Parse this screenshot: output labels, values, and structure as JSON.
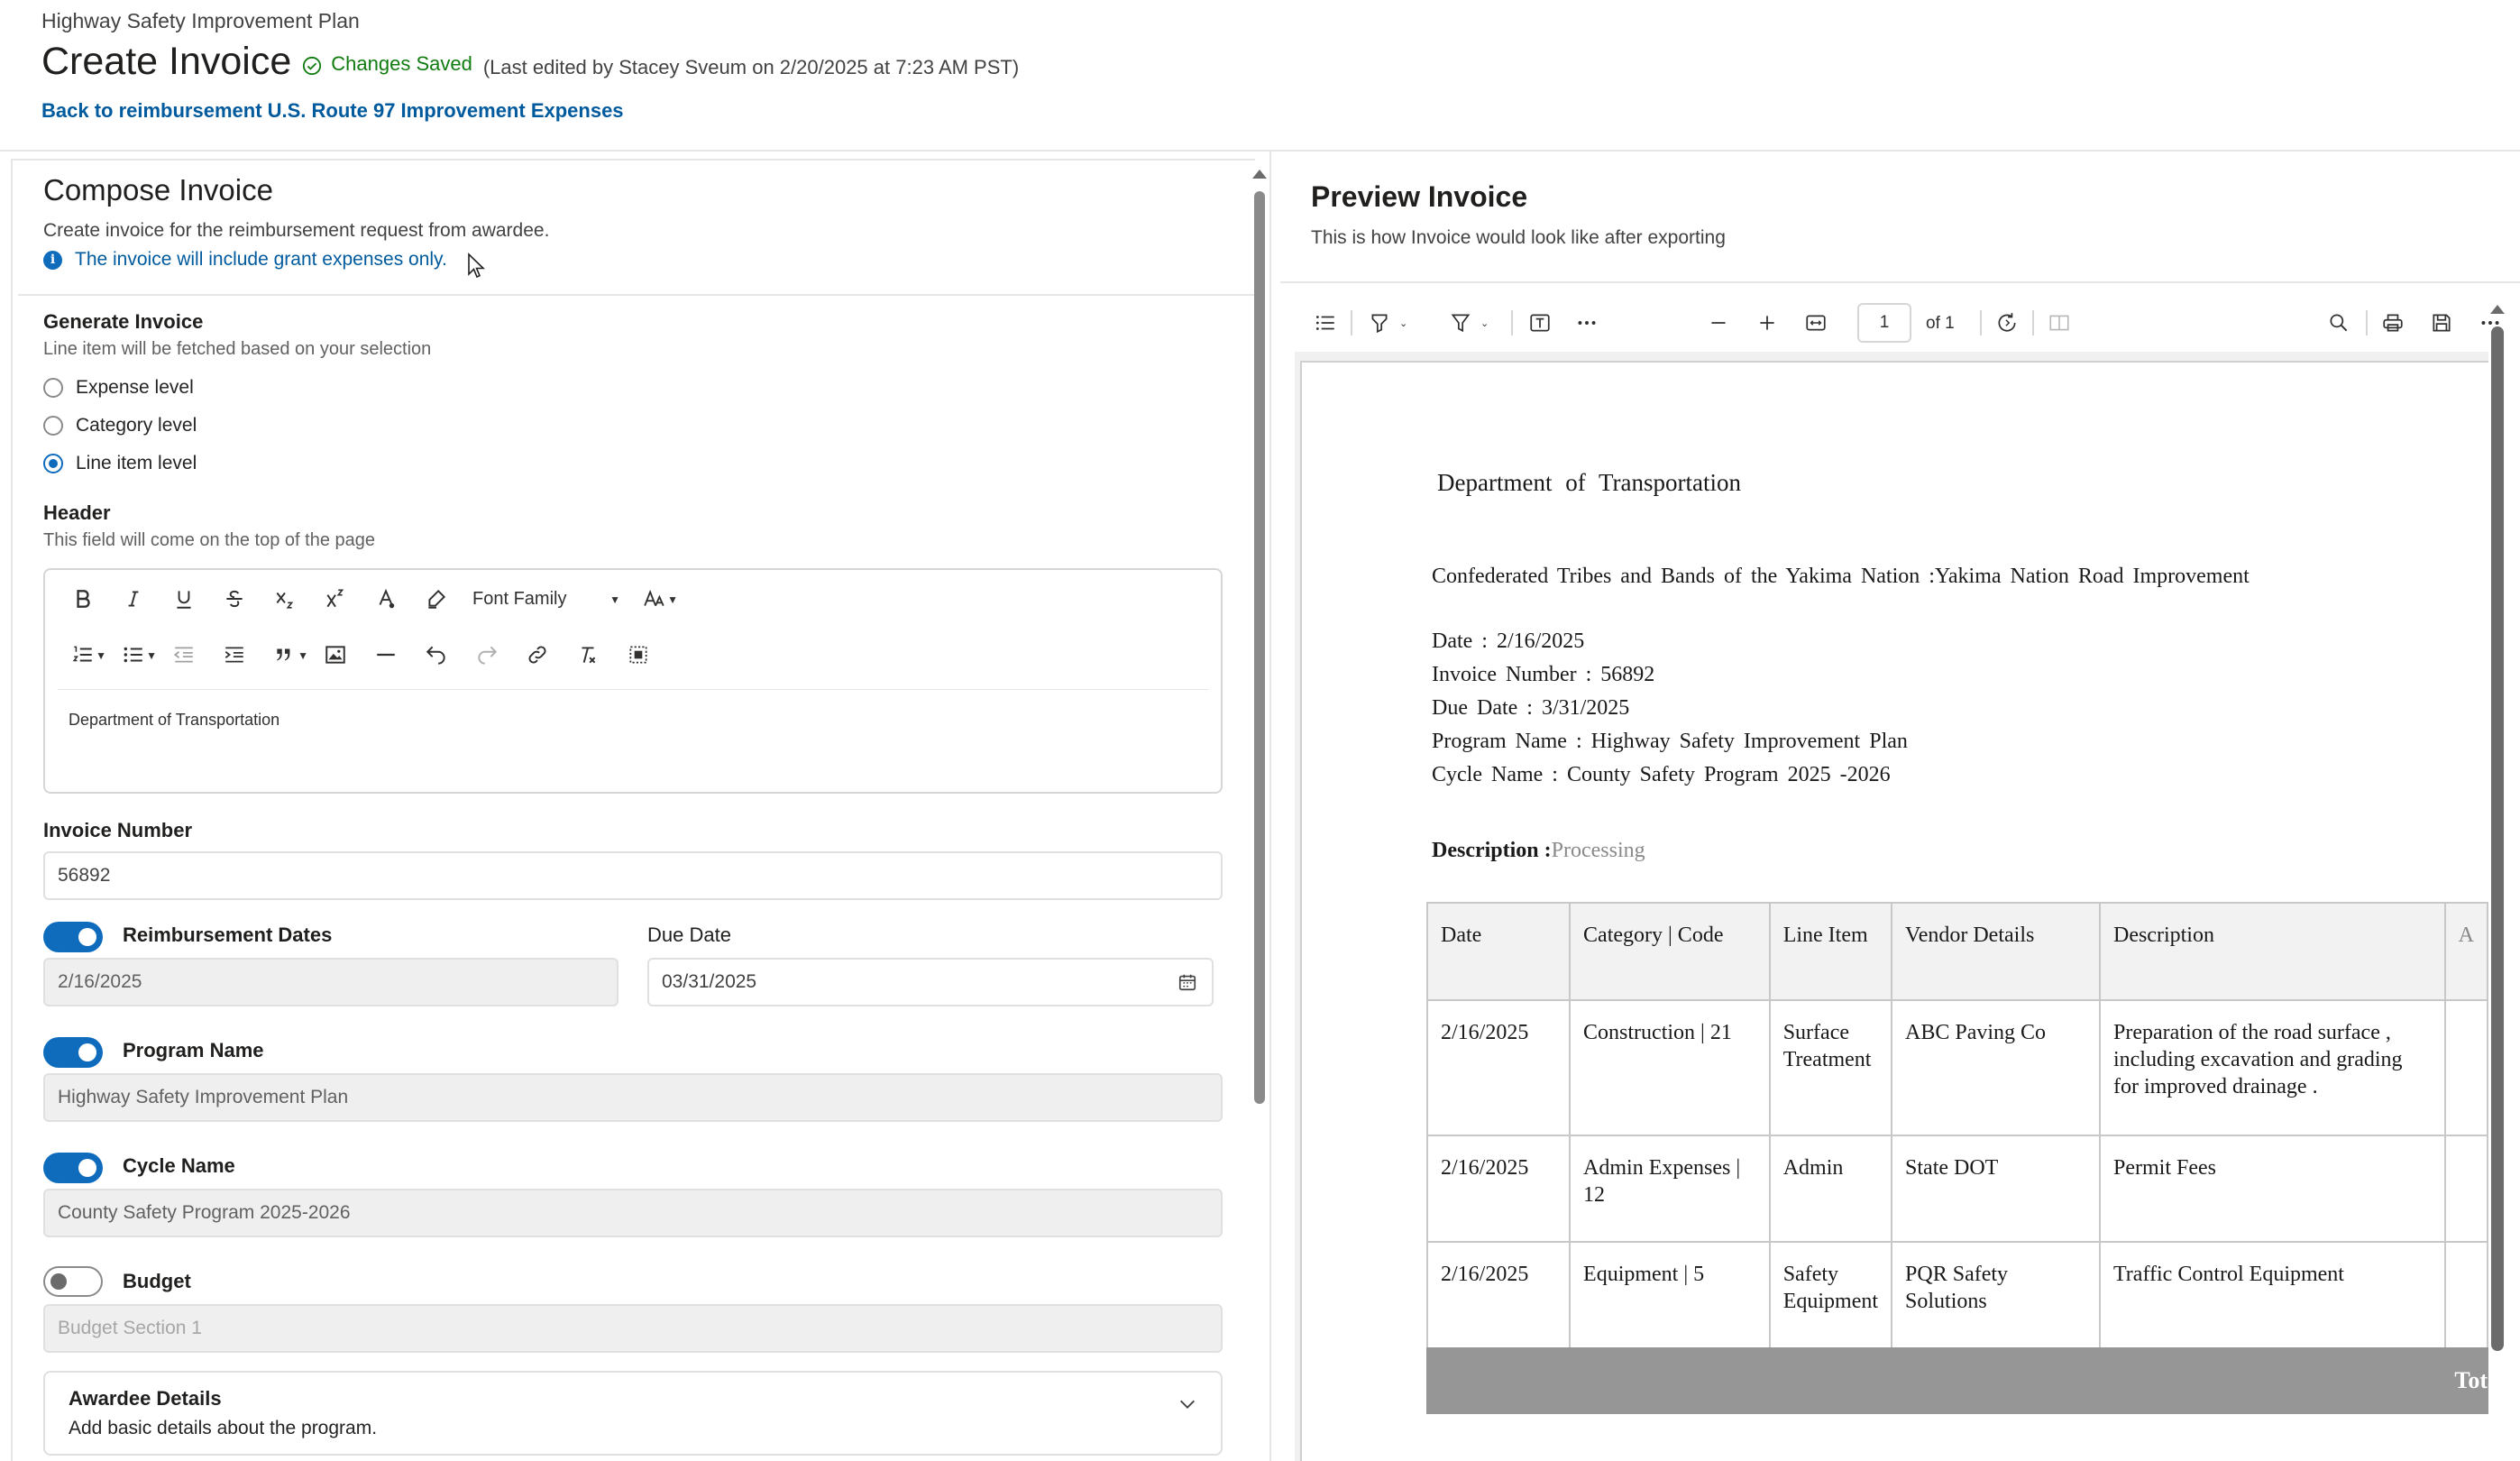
{
  "header": {
    "breadcrumb": "Highway Safety Improvement Plan",
    "title": "Create Invoice",
    "save_status": "Changes Saved",
    "last_edited": "(Last edited by Stacey Sveum on 2/20/2025 at 7:23 AM PST)",
    "back_link": "Back to reimbursement U.S. Route 97 Improvement Expenses"
  },
  "compose": {
    "title": "Compose Invoice",
    "description": "Create invoice for the reimbursement request from awardee.",
    "info": "The invoice will include grant expenses only.",
    "generate": {
      "label": "Generate Invoice",
      "help": "Line item will be fetched based on your selection",
      "options": [
        {
          "label": "Expense level",
          "checked": false
        },
        {
          "label": "Category level",
          "checked": false
        },
        {
          "label": "Line item level",
          "checked": true
        }
      ]
    },
    "header_field": {
      "label": "Header",
      "help": "This field will come on the top of the page",
      "font_family": "Font Family",
      "content": "Department of Transportation"
    },
    "invoice_number": {
      "label": "Invoice Number",
      "value": "56892"
    },
    "reimbursement_dates": {
      "label": "Reimbursement Dates",
      "enabled": true,
      "value": "2/16/2025"
    },
    "due_date": {
      "label": "Due Date",
      "value": "03/31/2025"
    },
    "program_name": {
      "label": "Program Name",
      "enabled": true,
      "value": "Highway Safety Improvement Plan"
    },
    "cycle_name": {
      "label": "Cycle Name",
      "enabled": true,
      "value": "County Safety Program 2025-2026"
    },
    "budget": {
      "label": "Budget",
      "enabled": false,
      "placeholder": "Budget Section 1"
    },
    "awardee": {
      "title": "Awardee Details",
      "description": "Add basic details about the program."
    }
  },
  "preview": {
    "title": "Preview Invoice",
    "description": "This is how Invoice would look like after exporting",
    "toolbar": {
      "page": "1",
      "of": "of 1"
    },
    "document": {
      "department": "Department of Transportation",
      "awardee_line": "Confederated Tribes and Bands of the Yakima Nation :Yakima Nation Road Improvement",
      "date": "Date : 2/16/2025",
      "invoice_number": "Invoice Number : 56892",
      "due_date": "Due Date : 3/31/2025",
      "program_name": "Program Name : Highway Safety Improvement Plan",
      "cycle_name": "Cycle Name : County Safety Program 2025 -2026",
      "description_label": "Description :",
      "description_value": "Processing",
      "table": {
        "headers": [
          "Date",
          "Category | Code",
          "Line Item",
          "Vendor Details",
          "Description",
          "A"
        ],
        "rows": [
          [
            "2/16/2025",
            "Construction | 21",
            "Surface Treatment",
            "ABC Paving Co",
            "Preparation of the road surface , including excavation and grading for improved drainage ."
          ],
          [
            "2/16/2025",
            "Admin Expenses | 12",
            "Admin",
            "State DOT",
            "Permit Fees"
          ],
          [
            "2/16/2025",
            "Equipment | 5",
            "Safety Equipment",
            "PQR Safety Solutions",
            "Traffic Control Equipment"
          ]
        ]
      },
      "total_label": "Tota"
    }
  },
  "colors": {
    "accent": "#0f6cbd",
    "link": "#005a9e",
    "success": "#107c10",
    "total_bar": "#969696"
  }
}
